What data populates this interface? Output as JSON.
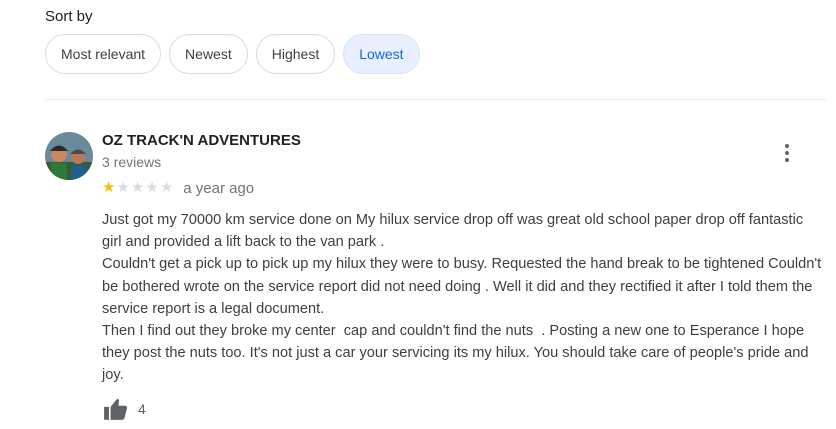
{
  "sort": {
    "label": "Sort by",
    "options": [
      "Most relevant",
      "Newest",
      "Highest",
      "Lowest"
    ],
    "selected": "Lowest"
  },
  "review": {
    "reviewer_name": "OZ TRACK'N ADVENTURES",
    "reviewer_count": "3 reviews",
    "rating": 1,
    "rating_max": 5,
    "date": "a year ago",
    "paragraphs": [
      "Just got my 70000 km service done on My hilux service drop off was great old school paper drop off fantastic girl and provided a lift back to the van park .",
      "Couldn't get a pick up to pick up my hilux they were to busy. Requested the hand break to be tightened Couldn't be bothered wrote on the service report did not need doing . Well it did and they rectified it after I told them the service report is a legal document.",
      "Then I find out they broke my center  cap and couldn't find the nuts  . Posting a new one to Esperance I hope they post the nuts too. It's not just a car your servicing its my hilux. You should take care of people's pride and joy."
    ],
    "likes": "4",
    "icons": {
      "avatar": "avatar-photo",
      "menu": "more-vert-icon",
      "like": "thumb-up-icon"
    }
  },
  "colors": {
    "selected_chip_bg": "#e8f0fe",
    "selected_chip_text": "#1967d2",
    "star_on": "#fbbc04",
    "star_off": "#dadce0"
  }
}
